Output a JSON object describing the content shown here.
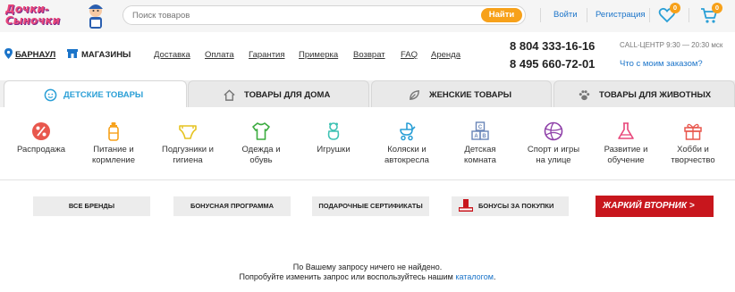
{
  "header": {
    "logo_text": "Дочки-Сыночки",
    "search_placeholder": "Поиск товаров",
    "search_button": "Найти",
    "login": "Войти",
    "register": "Регистрация",
    "favorites_count": "0",
    "cart_count": "0"
  },
  "info": {
    "city": "БАРНАУЛ",
    "shops": "МАГАЗИНЫ",
    "nav": [
      "Доставка",
      "Оплата",
      "Гарантия",
      "Примерка",
      "Возврат",
      "FAQ",
      "Аренда"
    ],
    "phone1": "8 804 333-16-16",
    "phone2": "8 495 660-72-01",
    "callcenter": "CALL-ЦЕНТР 9:30 — 20:30 мск",
    "order_link": "Что с моим заказом?"
  },
  "tabs": [
    {
      "label": "ДЕТСКИЕ ТОВАРЫ",
      "icon": "baby-icon"
    },
    {
      "label": "ТОВАРЫ ДЛЯ ДОМА",
      "icon": "house-icon"
    },
    {
      "label": "ЖЕНСКИЕ ТОВАРЫ",
      "icon": "leaf-icon"
    },
    {
      "label": "ТОВАРЫ ДЛЯ ЖИВОТНЫХ",
      "icon": "paw-icon"
    }
  ],
  "categories": [
    {
      "line1": "Распродажа",
      "line2": "",
      "icon": "percent-icon"
    },
    {
      "line1": "Питание и",
      "line2": "кормление",
      "icon": "bottle-icon"
    },
    {
      "line1": "Подгузники и",
      "line2": "гигиена",
      "icon": "diaper-icon"
    },
    {
      "line1": "Одежда и",
      "line2": "обувь",
      "icon": "shirt-icon"
    },
    {
      "line1": "Игрушки",
      "line2": "",
      "icon": "toy-icon"
    },
    {
      "line1": "Коляски и",
      "line2": "автокресла",
      "icon": "stroller-icon"
    },
    {
      "line1": "Детская",
      "line2": "комната",
      "icon": "blocks-icon"
    },
    {
      "line1": "Спорт и игры",
      "line2": "на улице",
      "icon": "ball-icon"
    },
    {
      "line1": "Развитие и",
      "line2": "обучение",
      "icon": "flask-icon"
    },
    {
      "line1": "Хобби и",
      "line2": "творчество",
      "icon": "gift-icon"
    }
  ],
  "promo": {
    "brands": "ВСЕ БРЕНДЫ",
    "bonus_program": "БОНУСНАЯ ПРОГРАММА",
    "certificates": "ПОДАРОЧНЫЕ СЕРТИФИКАТЫ",
    "bonus_purchases": "БОНУСЫ ЗА ПОКУПКИ",
    "hot_tuesday": "ЖАРКИЙ ВТОРНИК >"
  },
  "message": {
    "line1": "По Вашему запросу ничего не найдено.",
    "line2_pre": "Попробуйте изменить запрос или воспользуйтесь нашим ",
    "line2_link": "каталогом",
    "line2_post": "."
  },
  "colors": {
    "accent_blue": "#2a9fd6",
    "link_blue": "#1b74c9",
    "orange": "#f7a11a",
    "hot_red": "#c8161d",
    "icon_color": "#e8574d"
  }
}
